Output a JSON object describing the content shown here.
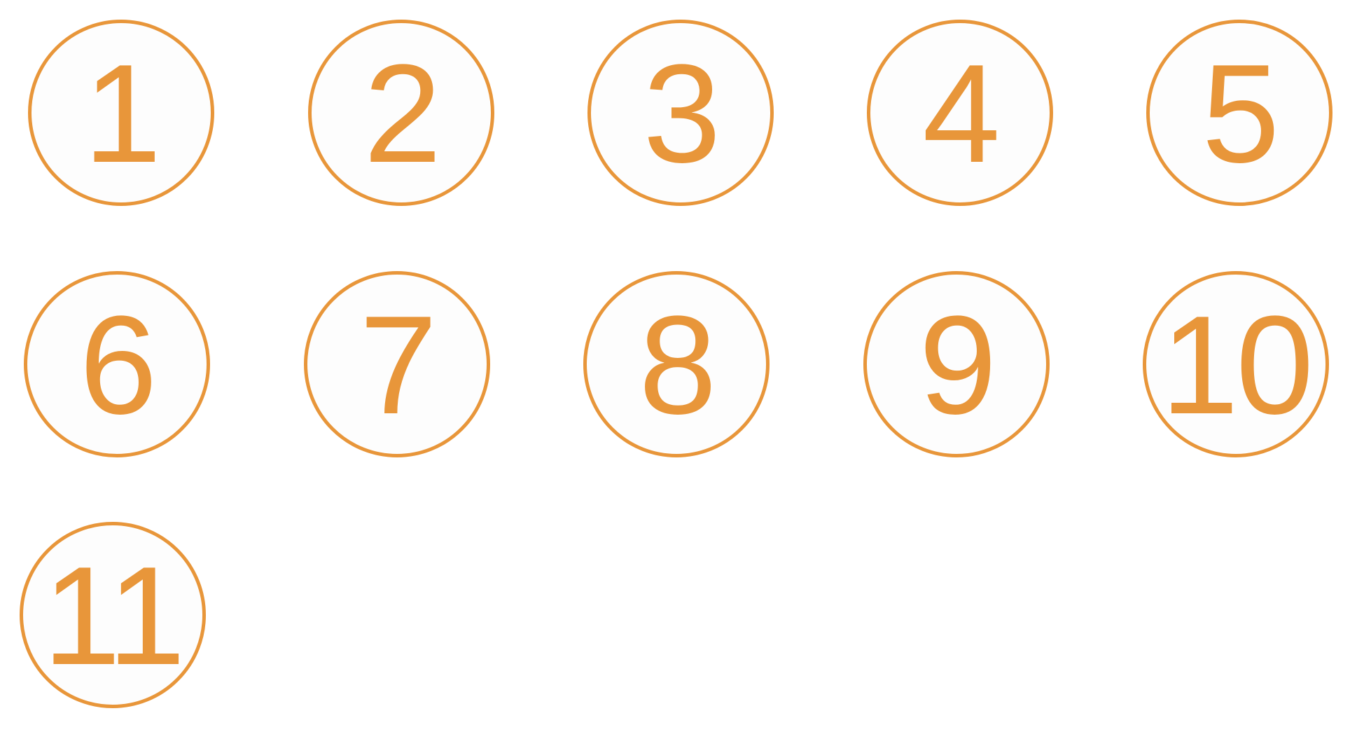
{
  "accent_color": "#E8963A",
  "badges": [
    {
      "label": "1"
    },
    {
      "label": "2"
    },
    {
      "label": "3"
    },
    {
      "label": "4"
    },
    {
      "label": "5"
    },
    {
      "label": "6"
    },
    {
      "label": "7"
    },
    {
      "label": "8"
    },
    {
      "label": "9"
    },
    {
      "label": "10"
    },
    {
      "label": "11"
    }
  ]
}
